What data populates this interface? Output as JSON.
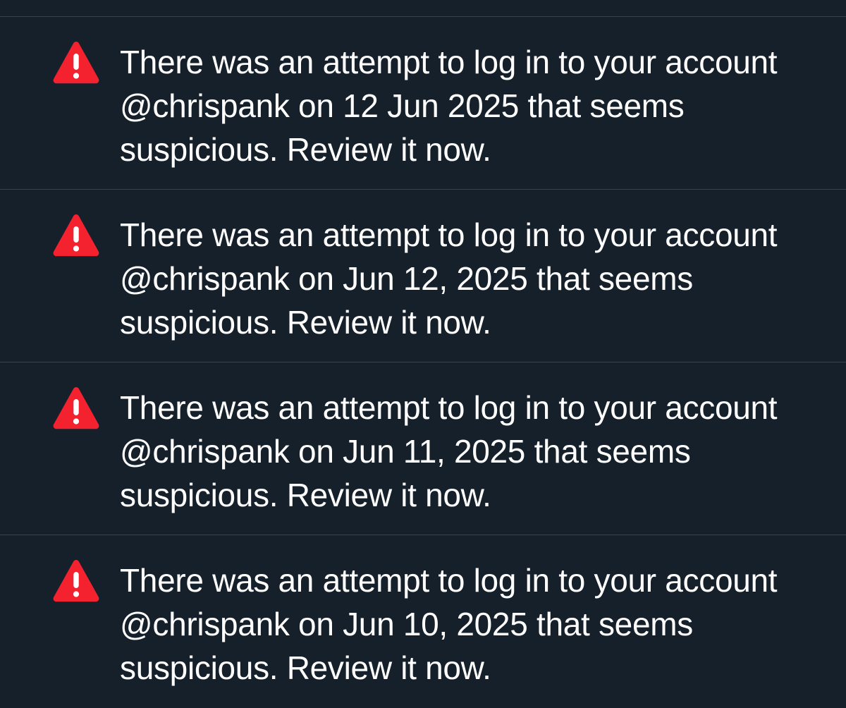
{
  "notifications": [
    {
      "icon": "warning-icon",
      "lines": [
        "There was an attempt to log in to your account",
        "@chrispank on 12 Jun 2025 that seems",
        "suspicious. Review it now."
      ]
    },
    {
      "icon": "warning-icon",
      "lines": [
        "There was an attempt to log in to your account",
        "@chrispank on Jun 12, 2025 that seems",
        "suspicious. Review it now."
      ]
    },
    {
      "icon": "warning-icon",
      "lines": [
        "There was an attempt to log in to your account",
        "@chrispank on Jun 11, 2025 that seems",
        "suspicious. Review it now."
      ]
    },
    {
      "icon": "warning-icon",
      "lines": [
        "There was an attempt to log in to your account",
        "@chrispank on Jun 10, 2025 that seems",
        "suspicious. Review it now."
      ]
    }
  ],
  "colors": {
    "background": "#15202b",
    "divider": "#38444d",
    "text": "#ffffff",
    "warning": "#f4212e"
  }
}
